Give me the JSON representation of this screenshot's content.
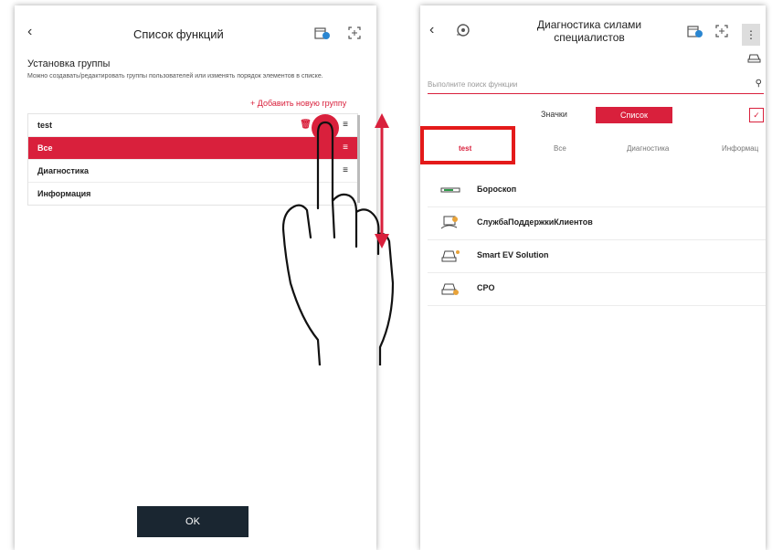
{
  "colors": {
    "accent": "#d9203c",
    "dark_button": "#1a2631"
  },
  "left": {
    "back_icon": "chevron-left-icon",
    "title": "Список функций",
    "header_icons": [
      "calendar-icon",
      "scan-icon"
    ],
    "section_title": "Установка группы",
    "section_desc": "Можно создавать/редактировать группы пользователей или изменять порядок элементов в списке.",
    "add_group_label": "+ Добавить новую группу",
    "groups": [
      {
        "label": "test",
        "selected": false,
        "has_trash": true
      },
      {
        "label": "Все",
        "selected": true,
        "has_trash": false
      },
      {
        "label": "Диагностика",
        "selected": false,
        "has_trash": false
      },
      {
        "label": "Информация",
        "selected": false,
        "has_trash": false
      }
    ],
    "ok_label": "OK"
  },
  "right": {
    "back_icon": "chevron-left-icon",
    "title_line1": "Диагностика силами",
    "title_line2": "специалистов",
    "search_placeholder": "Выполните поиск функции",
    "view_tabs": {
      "icons": "Значки",
      "list": "Список",
      "active": "list"
    },
    "categories": [
      "test",
      "Все",
      "Диагностика",
      "Информац"
    ],
    "active_category": "test",
    "functions": [
      {
        "label": "Бороскоп",
        "icon": "borescope-icon"
      },
      {
        "label": "СлужбаПоддержкиКлиентов",
        "icon": "customer-support-icon"
      },
      {
        "label": "Smart EV Solution",
        "icon": "ev-car-icon"
      },
      {
        "label": "CPO",
        "icon": "cpo-car-icon"
      }
    ]
  }
}
